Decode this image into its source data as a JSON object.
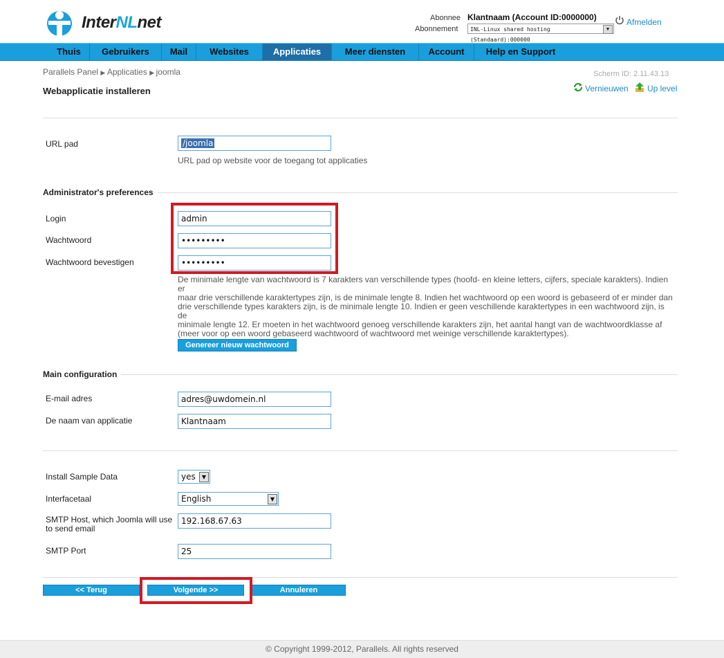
{
  "header": {
    "logo_prefix": "Inter",
    "logo_accent": "NL",
    "logo_suffix": "net",
    "subscriber_label": "Abonnee",
    "subscriber_value": "Klantnaam (Account ID:0000000)",
    "subscription_label": "Abonnement",
    "subscription_value": "INL-Linux shared hosting (Standaard):000000",
    "logout": "Afmelden"
  },
  "nav": {
    "items": [
      "Thuis",
      "Gebruikers",
      "Mail",
      "Websites",
      "Applicaties",
      "Meer diensten",
      "Account",
      "Help en Support"
    ],
    "active": "Applicaties"
  },
  "breadcrumb": [
    "Parallels Panel",
    "Applicaties",
    "joomla"
  ],
  "screen_id": "Scherm ID: 2.11.43.13",
  "toolbar": {
    "refresh": "Vernieuwen",
    "up": "Up level"
  },
  "page_title": "Webapplicatie installeren",
  "url_section": {
    "label": "URL pad",
    "value": "/joomla",
    "help": "URL pad op website voor de toegang tot applicaties"
  },
  "admin_section": {
    "title": "Administrator's preferences",
    "login_label": "Login",
    "login_value": "admin",
    "password_label": "Wachtwoord",
    "password_value": "•••••••••",
    "confirm_label": "Wachtwoord bevestigen",
    "confirm_value": "•••••••••",
    "help_lines": [
      "De minimale lengte van wachtwoord is 7 karakters van verschillende types (hoofd- en kleine letters, cijfers, speciale karakters). Indien er",
      "maar drie verschillende karaktertypes zijn, is de minimale lengte 8. Indien het wachtwoord op een woord is gebaseerd of er minder dan",
      "drie verschillende types karakters zijn, is de minimale lengte 10. Indien er geen veschillende karaktertypes in een wachtwoord zijn, is de",
      "minimale lengte 12. Er moeten in het wachtwoord genoeg verschillende karakters zijn, het aantal hangt van de wachtwoordklasse af",
      "(meer voor op een woord gebaseerd wachtwoord of wachtwoord met weinige verschillende karaktertypes)."
    ],
    "generate_button": "Genereer nieuw wachtwoord"
  },
  "main_section": {
    "title": "Main configuration",
    "email_label": "E-mail adres",
    "email_value": "adres@uwdomein.nl",
    "appname_label": "De naam van applicatie",
    "appname_value": "Klantnaam"
  },
  "extra_section": {
    "sample_label": "Install Sample Data",
    "sample_value": "yes",
    "lang_label": "Interfacetaal",
    "lang_value": "English",
    "smtp_host_label_1": "SMTP Host, which Joomla will use",
    "smtp_host_label_2": "to send email",
    "smtp_host_value": "192.168.67.63",
    "smtp_port_label": "SMTP Port",
    "smtp_port_value": "25"
  },
  "buttons": {
    "back": "<< Terug",
    "next": "Volgende >>",
    "cancel": "Annuleren"
  },
  "footer": "© Copyright 1999-2012, Parallels. All rights reserved",
  "colors": {
    "accent": "#1a9fdc",
    "nav_active": "#1e6ea8",
    "highlight": "#d11a24"
  }
}
